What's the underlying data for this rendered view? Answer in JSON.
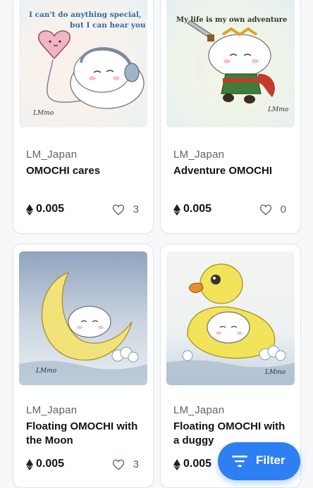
{
  "items": [
    {
      "image_caption": "I can't do anything special,\nbut I can hear you",
      "creator": "LM_Japan",
      "title": "OMOCHI cares",
      "price": "0.005",
      "likes": "3",
      "signature": "LMmo"
    },
    {
      "image_caption": "My life is my own adventure",
      "creator": "LM_Japan",
      "title": "Adventure OMOCHI",
      "price": "0.005",
      "likes": "0",
      "signature": "LMmo"
    },
    {
      "image_caption": "",
      "creator": "LM_Japan",
      "title": "Floating OMOCHI with the Moon",
      "price": "0.005",
      "likes": "3",
      "signature": "LMmo"
    },
    {
      "image_caption": "",
      "creator": "LM_Japan",
      "title": "Floating OMOCHI with a duggy",
      "price": "0.005",
      "likes": "",
      "signature": "LMmo"
    }
  ],
  "filter_button": {
    "label": "Filter",
    "icon": "filter-icon"
  },
  "colors": {
    "accent": "#2d7ff2",
    "card_border": "#e3e5ea",
    "background": "#f7f8fa"
  }
}
